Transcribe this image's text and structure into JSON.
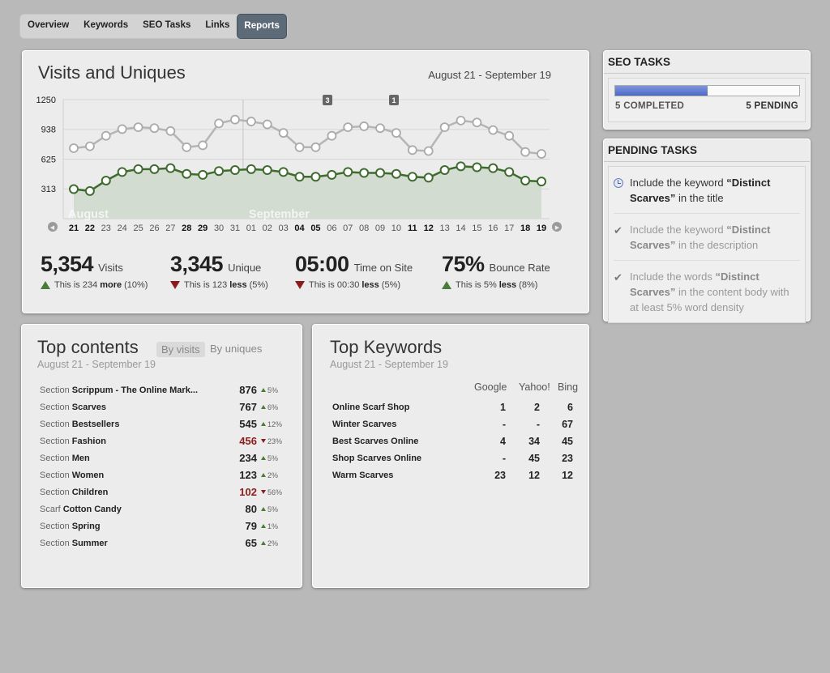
{
  "tabs": [
    "Overview",
    "Keywords",
    "SEO Tasks",
    "Links",
    "Reports"
  ],
  "active_tab": "Reports",
  "visits": {
    "title": "Visits and Uniques",
    "range": "August 21 - September 19",
    "month_labels": [
      "August",
      "September"
    ],
    "markers": [
      "3",
      "1"
    ],
    "stats": [
      {
        "value": "5,354",
        "label": "Visits",
        "dir": "up",
        "pre": "This is 234",
        "word": "more",
        "post": "(10%)"
      },
      {
        "value": "3,345",
        "label": "Unique",
        "dir": "down",
        "pre": "This is 123",
        "word": "less",
        "post": "(5%)"
      },
      {
        "value": "05:00",
        "label": "Time on Site",
        "dir": "down",
        "pre": "This is 00:30",
        "word": "less",
        "post": "(5%)"
      },
      {
        "value": "75%",
        "label": "Bounce Rate",
        "dir": "up",
        "pre": "This is 5%",
        "word": "less",
        "post": "(8%)"
      }
    ]
  },
  "chart_data": {
    "type": "line",
    "yticks": [
      "1250",
      "938",
      "625",
      "313"
    ],
    "ylim": [
      0,
      1250
    ],
    "x": [
      "21",
      "22",
      "23",
      "24",
      "25",
      "26",
      "27",
      "28",
      "29",
      "30",
      "31",
      "01",
      "02",
      "03",
      "04",
      "05",
      "06",
      "07",
      "08",
      "09",
      "10",
      "11",
      "12",
      "13",
      "14",
      "15",
      "16",
      "17",
      "18",
      "19"
    ],
    "bold_x": [
      "21",
      "22",
      "28",
      "29",
      "04",
      "05",
      "11",
      "12",
      "18",
      "19"
    ],
    "series": [
      {
        "values": [
          740,
          760,
          870,
          940,
          960,
          950,
          920,
          750,
          770,
          1000,
          1040,
          1020,
          990,
          900,
          750,
          750,
          870,
          960,
          970,
          950,
          900,
          720,
          710,
          960,
          1030,
          1010,
          930,
          870,
          700,
          680
        ]
      },
      {
        "values": [
          310,
          290,
          400,
          490,
          520,
          520,
          530,
          470,
          460,
          500,
          510,
          520,
          510,
          490,
          440,
          440,
          460,
          490,
          480,
          480,
          470,
          440,
          430,
          510,
          550,
          540,
          530,
          490,
          400,
          390
        ]
      }
    ],
    "colors": {
      "upper": "#b5b5b5",
      "lower": "#3f6b2f",
      "fill": "#d3dcd0"
    }
  },
  "seo_tasks": {
    "title": "SEO TASKS",
    "progress_fraction": 0.5,
    "completed": "5 COMPLETED",
    "pending": "5 PENDING"
  },
  "pending_tasks": {
    "title": "PENDING TASKS",
    "items": [
      {
        "pre": "Include the keyword ",
        "bold": "“Distinct Scarves”",
        "post": " in the title",
        "status": "current"
      },
      {
        "pre": "Include the keyword ",
        "bold": "“Distinct Scarves”",
        "post": " in the description",
        "status": "done"
      },
      {
        "pre": "Include the words ",
        "bold": "“Distinct Scarves”",
        "post": " in the content body with at least 5% word density",
        "status": "done"
      }
    ]
  },
  "top_contents": {
    "title": "Top contents",
    "by_visits": "By visits",
    "by_uniques": "By uniques",
    "range": "August 21 - September 19",
    "rows": [
      {
        "prefix": "Section",
        "name": "Scrippum - The Online Mark...",
        "value": "876",
        "dir": "up",
        "pct": "5%"
      },
      {
        "prefix": "Section",
        "name": "Scarves",
        "value": "767",
        "dir": "up",
        "pct": "6%"
      },
      {
        "prefix": "Section",
        "name": "Bestsellers",
        "value": "545",
        "dir": "up",
        "pct": "12%"
      },
      {
        "prefix": "Section",
        "name": "Fashion",
        "value": "456",
        "dir": "down",
        "pct": "23%"
      },
      {
        "prefix": "Section",
        "name": "Men",
        "value": "234",
        "dir": "up",
        "pct": "5%"
      },
      {
        "prefix": "Section",
        "name": "Women",
        "value": "123",
        "dir": "up",
        "pct": "2%"
      },
      {
        "prefix": "Section",
        "name": "Children",
        "value": "102",
        "dir": "down",
        "pct": "56%"
      },
      {
        "prefix": "Scarf",
        "name": "Cotton Candy",
        "value": "80",
        "dir": "up",
        "pct": "5%"
      },
      {
        "prefix": "Section",
        "name": "Spring",
        "value": "79",
        "dir": "up",
        "pct": "1%"
      },
      {
        "prefix": "Section",
        "name": "Summer",
        "value": "65",
        "dir": "up",
        "pct": "2%"
      }
    ]
  },
  "top_keywords": {
    "title": "Top Keywords",
    "range": "August 21 - September 19",
    "columns": [
      "Google",
      "Yahoo!",
      "Bing"
    ],
    "rows": [
      {
        "keyword": "Online Scarf Shop",
        "google": "1",
        "yahoo": "2",
        "bing": "6"
      },
      {
        "keyword": "Winter Scarves",
        "google": "-",
        "yahoo": "-",
        "bing": "67"
      },
      {
        "keyword": "Best Scarves Online",
        "google": "4",
        "yahoo": "34",
        "bing": "45"
      },
      {
        "keyword": "Shop Scarves Online",
        "google": "-",
        "yahoo": "45",
        "bing": "23"
      },
      {
        "keyword": "Warm Scarves",
        "google": "23",
        "yahoo": "12",
        "bing": "12"
      }
    ]
  }
}
